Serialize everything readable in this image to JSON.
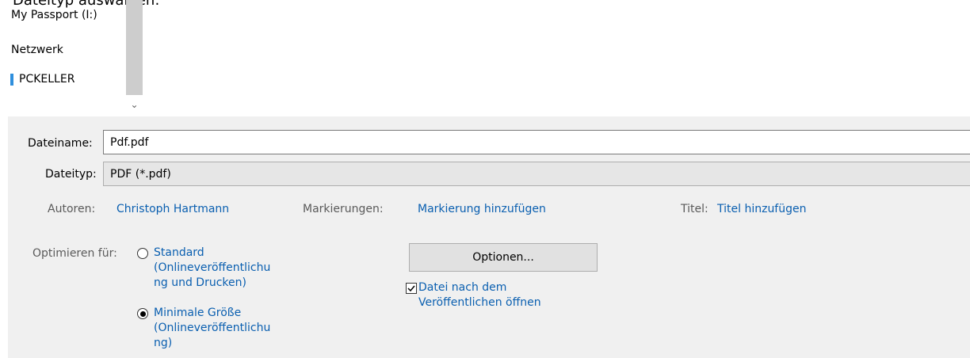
{
  "caption": "Dateityp auswählen:",
  "nav": {
    "items": [
      "My Passport (I:)",
      "Netzwerk",
      "PCKELLER"
    ]
  },
  "form": {
    "filename_label": "Dateiname:",
    "filename_value": "Pdf.pdf",
    "filetype_label": "Dateityp:",
    "filetype_value": "PDF (*.pdf)"
  },
  "meta": {
    "authors_label": "Autoren:",
    "authors_value": "Christoph Hartmann",
    "tags_label": "Markierungen:",
    "tags_value": "Markierung hinzufügen",
    "title_label": "Titel:",
    "title_value": "Titel hinzufügen"
  },
  "optimize": {
    "label": "Optimieren für:",
    "options": [
      {
        "lines": [
          "Standard",
          "(Onlineveröffentlichu",
          "ng und Drucken)"
        ],
        "selected": false
      },
      {
        "lines": [
          "Minimale Größe",
          "(Onlineveröffentlichu",
          "ng)"
        ],
        "selected": true
      }
    ]
  },
  "options_button": "Optionen...",
  "open_after_publish": {
    "lines": [
      "Datei nach dem",
      "Veröffentlichen öffnen"
    ],
    "checked": true
  }
}
